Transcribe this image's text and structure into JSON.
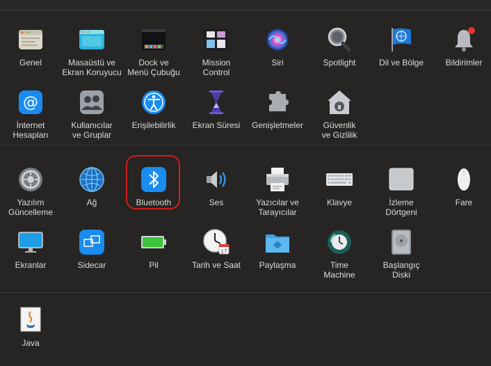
{
  "rows": [
    [
      {
        "label": "Genel",
        "name": "pref-genel",
        "icon": "general-icon"
      },
      {
        "label": "Masaüstü ve\nEkran Koruyucu",
        "name": "pref-masaustu",
        "icon": "desktop-screensaver-icon"
      },
      {
        "label": "Dock ve\nMenü Çubuğu",
        "name": "pref-dock",
        "icon": "dock-icon"
      },
      {
        "label": "Mission\nControl",
        "name": "pref-mission-control",
        "icon": "mission-control-icon"
      },
      {
        "label": "Siri",
        "name": "pref-siri",
        "icon": "siri-icon"
      },
      {
        "label": "Spotlight",
        "name": "pref-spotlight",
        "icon": "spotlight-icon"
      },
      {
        "label": "Dil ve Bölge",
        "name": "pref-dil-bolge",
        "icon": "language-region-icon"
      },
      {
        "label": "Bildirimler",
        "name": "pref-bildirimler",
        "icon": "notifications-icon"
      }
    ],
    [
      {
        "label": "İnternet\nHesapları",
        "name": "pref-internet-hesaplari",
        "icon": "internet-accounts-icon"
      },
      {
        "label": "Kullanıcılar\nve Gruplar",
        "name": "pref-kullanicilar",
        "icon": "users-groups-icon"
      },
      {
        "label": "Erişilebilirlik",
        "name": "pref-erisilebilirlik",
        "icon": "accessibility-icon"
      },
      {
        "label": "Ekran Süresi",
        "name": "pref-ekran-suresi",
        "icon": "screen-time-icon"
      },
      {
        "label": "Genişletmeler",
        "name": "pref-genisletmeler",
        "icon": "extensions-icon"
      },
      {
        "label": "Güvenlik\nve Gizlilik",
        "name": "pref-guvenlik",
        "icon": "security-privacy-icon"
      }
    ],
    [
      {
        "label": "Yazılım\nGüncelleme",
        "name": "pref-yazilim-guncelleme",
        "icon": "software-update-icon"
      },
      {
        "label": "Ağ",
        "name": "pref-ag",
        "icon": "network-icon"
      },
      {
        "label": "Bluetooth",
        "name": "pref-bluetooth",
        "icon": "bluetooth-icon"
      },
      {
        "label": "Ses",
        "name": "pref-ses",
        "icon": "sound-icon"
      },
      {
        "label": "Yazıcılar ve\nTarayıcılar",
        "name": "pref-yazicilar",
        "icon": "printers-scanners-icon"
      },
      {
        "label": "Klavye",
        "name": "pref-klavye",
        "icon": "keyboard-icon"
      },
      {
        "label": "İzleme\nDörtgeni",
        "name": "pref-izleme-dortgeni",
        "icon": "trackpad-icon"
      },
      {
        "label": "Fare",
        "name": "pref-fare",
        "icon": "mouse-icon"
      }
    ],
    [
      {
        "label": "Ekranlar",
        "name": "pref-ekranlar",
        "icon": "displays-icon"
      },
      {
        "label": "Sidecar",
        "name": "pref-sidecar",
        "icon": "sidecar-icon"
      },
      {
        "label": "Pil",
        "name": "pref-pil",
        "icon": "battery-icon"
      },
      {
        "label": "Tarih ve Saat",
        "name": "pref-tarih-saat",
        "icon": "date-time-icon"
      },
      {
        "label": "Paylaşma",
        "name": "pref-paylasma",
        "icon": "sharing-icon"
      },
      {
        "label": "Time\nMachine",
        "name": "pref-time-machine",
        "icon": "time-machine-icon"
      },
      {
        "label": "Başlangıç\nDiski",
        "name": "pref-baslangic-diski",
        "icon": "startup-disk-icon"
      }
    ],
    [
      {
        "label": "Java",
        "name": "pref-java",
        "icon": "java-icon"
      }
    ]
  ],
  "date_time_icon_day": "17"
}
